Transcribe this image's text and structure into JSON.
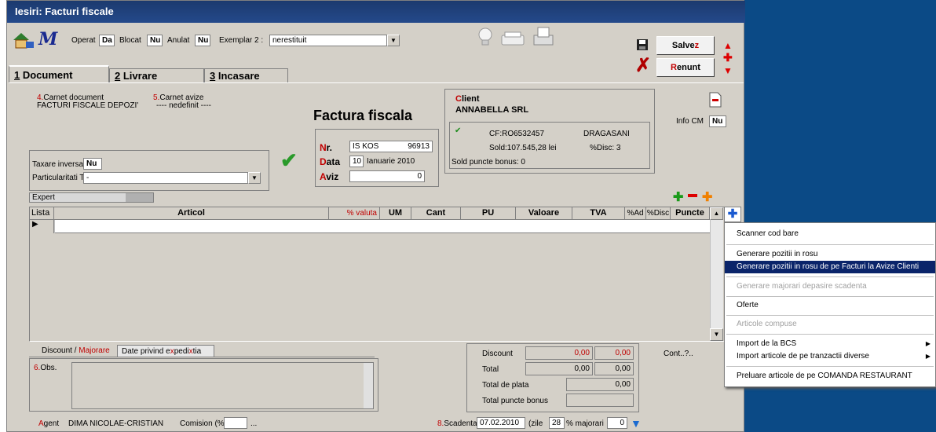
{
  "window": {
    "title": "Iesiri: Facturi fiscale"
  },
  "toolbar": {
    "operat_label": "Operat",
    "operat_value": "Da",
    "blocat_label": "Blocat",
    "blocat_value": "Nu",
    "anulat_label": "Anulat",
    "anulat_value": "Nu",
    "exemplar_label": "Exemplar 2 :",
    "exemplar_value": "nerestituit",
    "save_label_main": "Salve",
    "save_label_accent": "z",
    "cancel_label_accent": "R",
    "cancel_label_main": "enunt"
  },
  "tabs": [
    {
      "num": "1",
      "label": " Document"
    },
    {
      "num": "2",
      "label": " Livrare"
    },
    {
      "num": "3",
      "label": " Incasare"
    }
  ],
  "document": {
    "carnet_doc_label_num": "4.",
    "carnet_doc_label": "Carnet document",
    "carnet_doc_value": "FACTURI FISCALE DEPOZI'",
    "carnet_avize_label_num": "5.",
    "carnet_avize_label": "Carnet avize",
    "carnet_avize_value": "---- nedefinit ----",
    "heading": "Factura fiscala",
    "nr_label_a": "N",
    "nr_label_b": "r.",
    "nr_series": "IS KOS",
    "nr_value": "96913",
    "data_label_a": "D",
    "data_label_b": "ata",
    "data_day": "10",
    "data_month": "Ianuarie 2010",
    "aviz_label_a": "A",
    "aviz_label_b": "viz",
    "aviz_value": "0",
    "taxare_label": "Taxare inversa",
    "taxare_value": "Nu",
    "particularitati_label": "Particularitati TVA",
    "particularitati_value": "-"
  },
  "client": {
    "label_a": "C",
    "label_b": "lient",
    "name": "ANNABELLA SRL",
    "cf": "CF:RO6532457",
    "city": "DRAGASANI",
    "sold": "Sold:107.545,28 lei",
    "disc": "%Disc: 3",
    "bonus": "Sold puncte bonus:  0"
  },
  "infocm": {
    "label": "Info CM",
    "value": "Nu"
  },
  "expert": {
    "label": "Expert"
  },
  "grid": {
    "columns": [
      "Lista",
      "Articol",
      "% valuta",
      "UM",
      "Cant",
      "PU",
      "Valoare",
      "TVA",
      "%Ad",
      "%Disc",
      "Puncte"
    ]
  },
  "bottom": {
    "tab1_a": "Discount /",
    "tab1_b": " Majorare",
    "tab2_a": "Date privind e",
    "tab2_b": "x",
    "tab2_c": "pedi",
    "tab2_d": "tia",
    "obs_num": "6.",
    "obs_label": "Obs.",
    "agent_a": "A",
    "agent_b": "gent",
    "agent_value": "DIMA NICOLAE-CRISTIAN",
    "comision_label": "Comision (%)",
    "comision_dots": "...",
    "scadenta_num": "8.",
    "scadenta_label": "Scadenta",
    "scadenta_value": "07.02.2010",
    "zile_label": "(zile",
    "zile_value": "28",
    "majorari_label": "% majorari",
    "majorari_value": "0"
  },
  "totals": {
    "discount_label": "Discount",
    "discount_v1": "0,00",
    "discount_v2": "0,00",
    "total_label": "Total",
    "total_v1": "0,00",
    "total_v2": "0,00",
    "plata_label": "Total de plata",
    "plata_v": "0,00",
    "bonus_label": "Total puncte bonus",
    "cont_label": "Cont..?.."
  },
  "menu": {
    "items": [
      "Scanner cod bare",
      "Generare pozitii in rosu",
      "Generare pozitii in rosu de pe Facturi la Avize Clienti",
      "Generare majorari depasire scadenta",
      "Oferte",
      "Articole compuse",
      "Import de la BCS",
      "Import articole de pe tranzactii diverse",
      "Preluare articole de pe COMANDA RESTAURANT"
    ]
  },
  "colors": {
    "title_bar": "#24498a",
    "menu_highlight": "#0a246a",
    "background_right": "#0b4a86",
    "accent_red": "#c00000"
  }
}
